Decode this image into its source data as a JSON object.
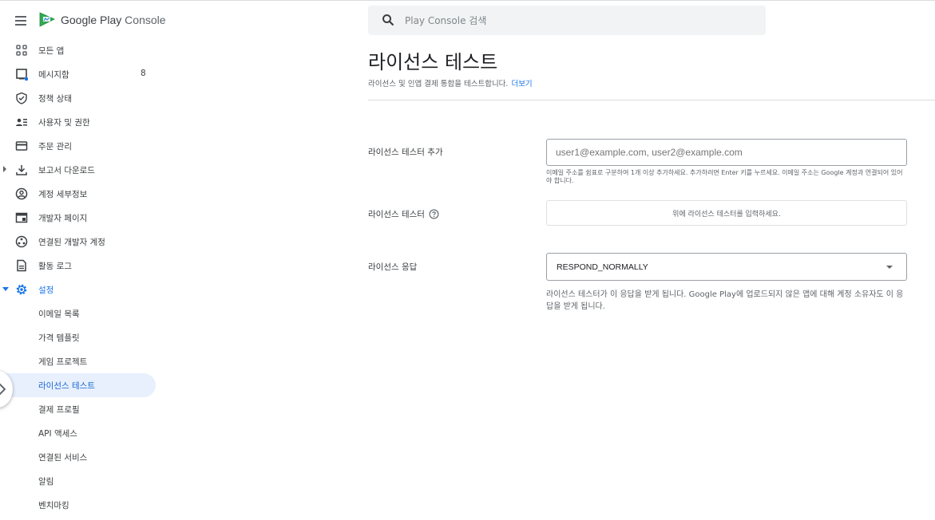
{
  "brand": {
    "name": "Google Play",
    "suffix": "Console"
  },
  "sidebar": {
    "items": [
      {
        "label": "모든 앱",
        "icon": "apps-grid-icon"
      },
      {
        "label": "메시지함",
        "icon": "inbox-icon",
        "count": "8"
      },
      {
        "label": "정책 상태",
        "icon": "shield-check-icon"
      },
      {
        "label": "사용자 및 권한",
        "icon": "users-icon"
      },
      {
        "label": "주문 관리",
        "icon": "credit-card-icon"
      },
      {
        "label": "보고서 다운로드",
        "icon": "download-icon"
      },
      {
        "label": "계정 세부정보",
        "icon": "account-circle-icon"
      },
      {
        "label": "개발자 페이지",
        "icon": "web-page-icon"
      },
      {
        "label": "연결된 개발자 계정",
        "icon": "linked-accounts-icon"
      },
      {
        "label": "활동 로그",
        "icon": "document-icon"
      },
      {
        "label": "설정",
        "icon": "gear-icon"
      }
    ],
    "settings_sub": [
      {
        "label": "이메일 목록"
      },
      {
        "label": "가격 템플릿"
      },
      {
        "label": "게임 프로젝트"
      },
      {
        "label": "라이선스 테스트"
      },
      {
        "label": "결제 프로필"
      },
      {
        "label": "API 액세스"
      },
      {
        "label": "연결된 서비스"
      },
      {
        "label": "알림"
      },
      {
        "label": "벤치마킹"
      }
    ]
  },
  "search": {
    "placeholder": "Play Console 검색"
  },
  "main": {
    "title": "라이선스 테스트",
    "subtitle": "라이선스 및 인앱 결제 통합을 테스트합니다.",
    "more_link": "더보기",
    "add_testers": {
      "label": "라이선스 테스터 추가",
      "placeholder": "user1@example.com, user2@example.com",
      "hint": "이메일 주소를 쉼표로 구분하여 1개 이상 추가하세요. 추가하려면 Enter 키를 누르세요. 이메일 주소는 Google 계정과 연결되어 있어야 합니다."
    },
    "testers": {
      "label": "라이선스 테스터",
      "empty": "위에 라이선스 테스터를 입력하세요."
    },
    "response": {
      "label": "라이선스 응답",
      "value": "RESPOND_NORMALLY",
      "note": "라이선스 테스터가 이 응답을 받게 됩니다. Google Play에 업로드되지 않은 앱에 대해 계정 소유자도 이 응답을 받게 됩니다."
    }
  },
  "colors": {
    "accent": "#1a73e8",
    "selected_bg": "#e8f0fe",
    "text": "#3c4043"
  }
}
